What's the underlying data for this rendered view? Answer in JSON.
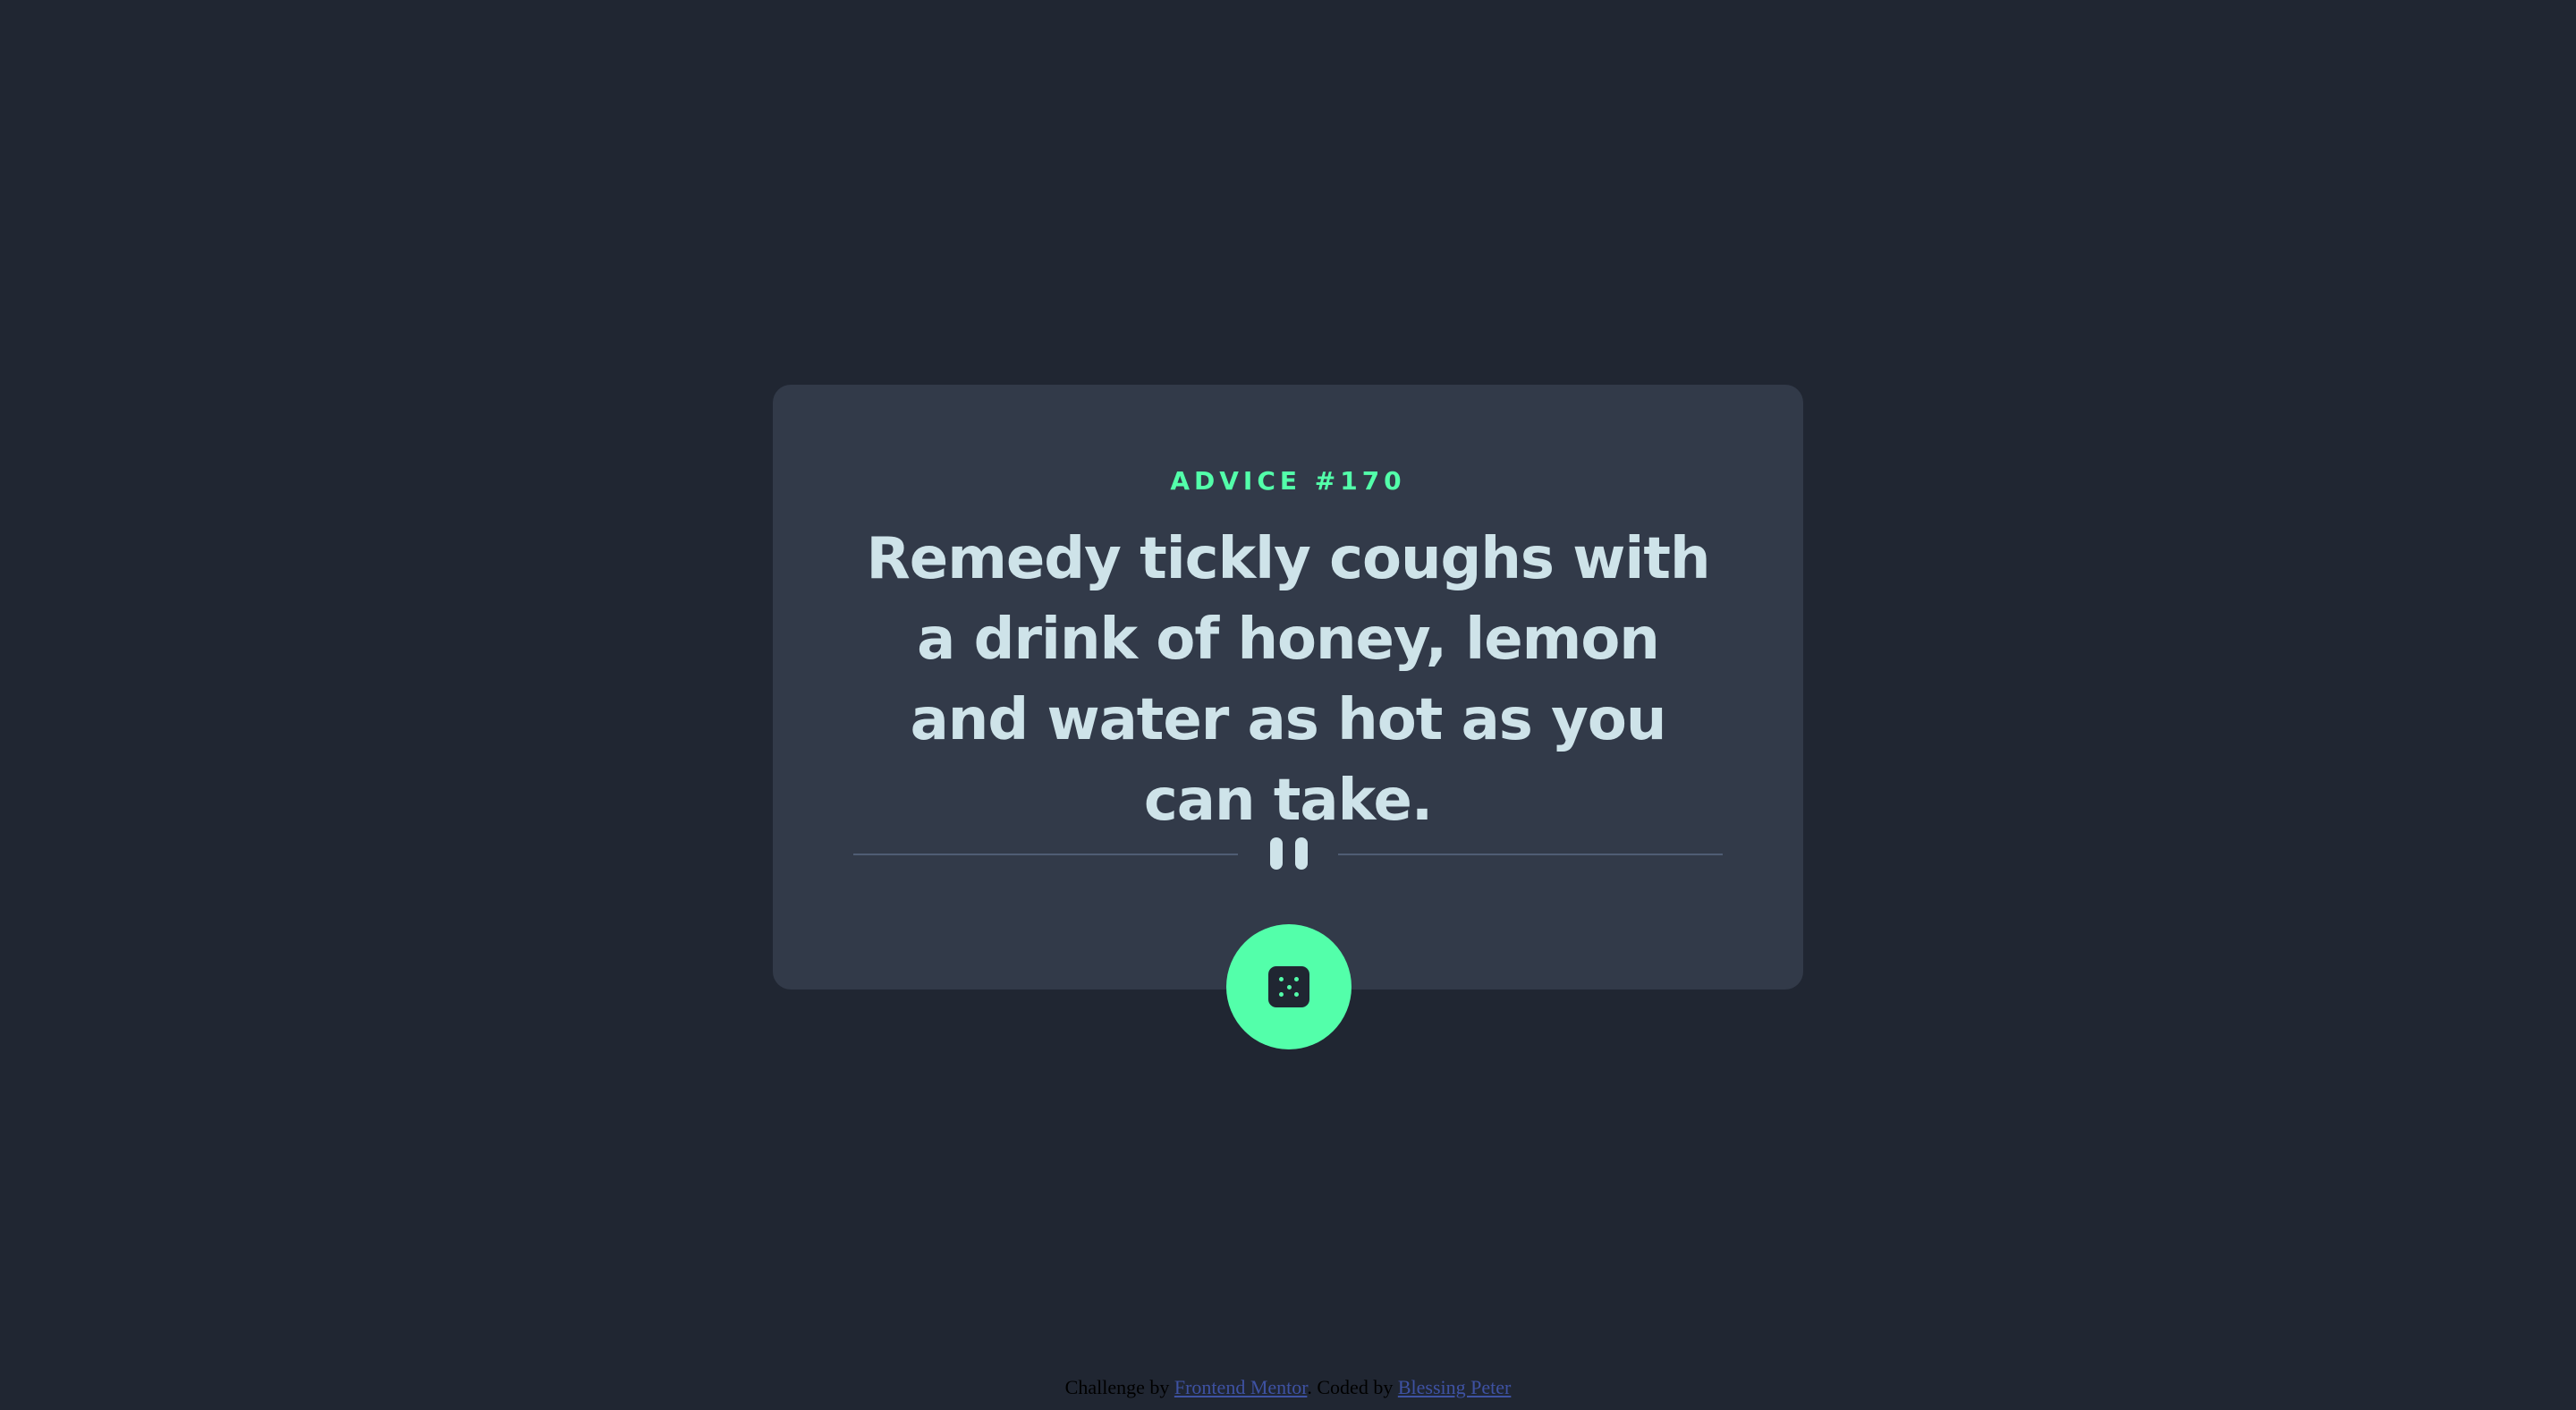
{
  "card": {
    "label": "ADVICE #170",
    "advice": "Remedy tickly coughs with a drink of honey, lemon and water as hot as you can take."
  },
  "button": {
    "icon": "dice-icon"
  },
  "footer": {
    "prefix": "Challenge by ",
    "challenge_link": "Frontend Mentor",
    "middle": ". Coded by ",
    "author_link": "Blessing Peter"
  },
  "colors": {
    "background": "#202632",
    "card": "#323a49",
    "accent": "#53ffaa",
    "text": "#cee3e9",
    "divider": "#4f5d74",
    "link": "#3e52a3"
  }
}
